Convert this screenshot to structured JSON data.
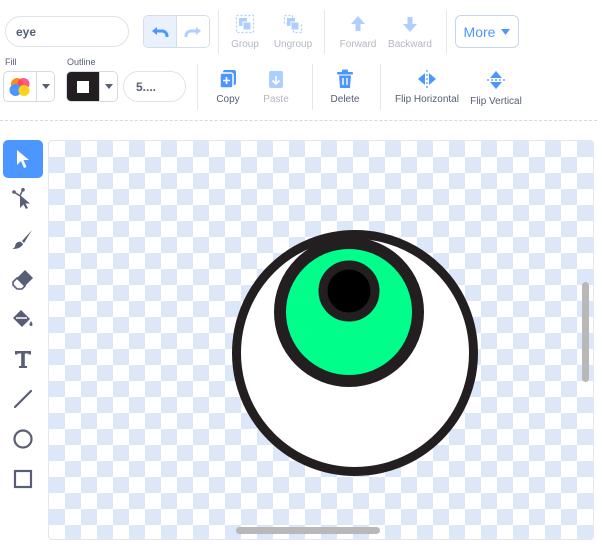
{
  "costume": {
    "name": "eye"
  },
  "top_toolbar": {
    "group_label": "Group",
    "ungroup_label": "Ungroup",
    "forward_label": "Forward",
    "backward_label": "Backward",
    "more_label": "More"
  },
  "style_bar": {
    "fill_label": "Fill",
    "outline_label": "Outline",
    "outline_width": "5....",
    "copy_label": "Copy",
    "paste_label": "Paste",
    "delete_label": "Delete",
    "flip_h_label": "Flip Horizontal",
    "flip_v_label": "Flip Vertical"
  },
  "colors": {
    "accent": "#4c97ff",
    "outline_color": "#231f20",
    "iris": "#00ff8a",
    "pupil": "#000000",
    "delete_icon": "#4c97ff"
  },
  "tools": [
    {
      "name": "select-tool",
      "icon": "arrow-icon",
      "selected": true
    },
    {
      "name": "reshape-tool",
      "icon": "reshape-icon"
    },
    {
      "name": "brush-tool",
      "icon": "brush-icon"
    },
    {
      "name": "eraser-tool",
      "icon": "eraser-icon"
    },
    {
      "name": "fill-tool",
      "icon": "bucket-icon"
    },
    {
      "name": "text-tool",
      "icon": "text-icon",
      "glyph": "T"
    },
    {
      "name": "line-tool",
      "icon": "line-icon"
    },
    {
      "name": "circle-tool",
      "icon": "circle-icon"
    },
    {
      "name": "rectangle-tool",
      "icon": "rectangle-icon"
    }
  ]
}
